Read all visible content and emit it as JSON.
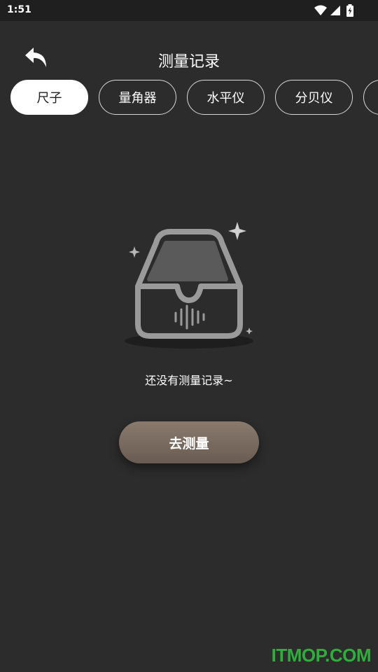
{
  "status_bar": {
    "time": "1:51",
    "icons": [
      "wifi-icon",
      "signal-icon",
      "battery-charging-icon"
    ]
  },
  "header": {
    "back_icon": "back-arrow-icon",
    "title": "测量记录"
  },
  "tabs": [
    {
      "label": "尺子",
      "active": true
    },
    {
      "label": "量角器",
      "active": false
    },
    {
      "label": "水平仪",
      "active": false
    },
    {
      "label": "分贝仪",
      "active": false
    },
    {
      "label": "",
      "active": false
    }
  ],
  "empty_state": {
    "illustration": "empty-box-sound-icon",
    "message": "还没有测量记录~",
    "button_label": "去测量"
  },
  "watermark": "ITMOP.COM",
  "colors": {
    "background": "#2c2c2c",
    "status_bar": "#1f1f1f",
    "button": "#7a6b60",
    "watermark": "#2fae3d"
  }
}
